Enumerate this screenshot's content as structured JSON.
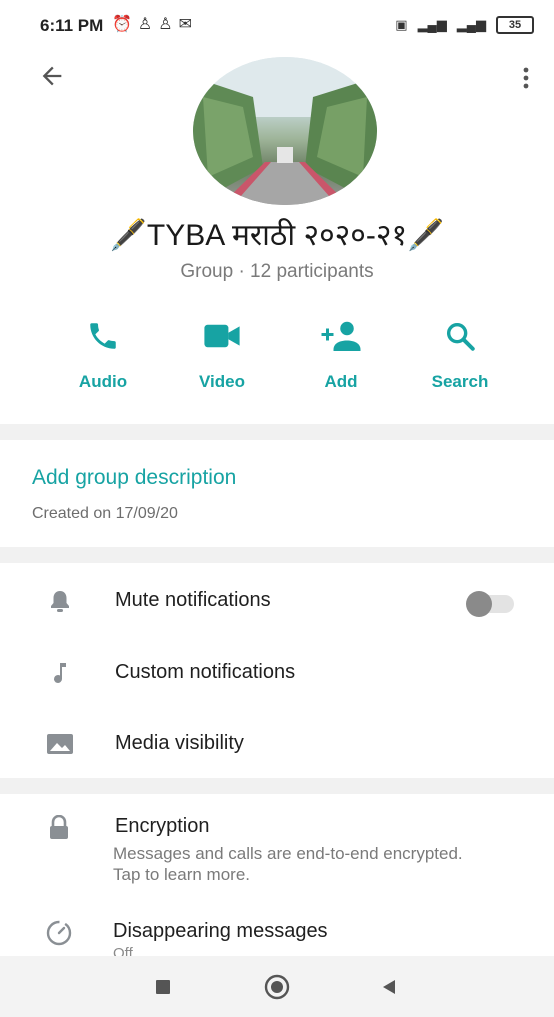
{
  "status_bar": {
    "time": "6:11 PM",
    "left_icons": [
      "alarm-off-icon",
      "person-icon",
      "person-icon",
      "gmail-icon"
    ],
    "right_icons": [
      "vibrate-icon",
      "signal-4g-icon",
      "signal-icon"
    ],
    "battery_level": "35"
  },
  "header": {
    "back_icon": "arrow-back-icon",
    "menu_icon": "more-vert-icon"
  },
  "group": {
    "title": "🖋️TYBA मराठी २०२०-२१🖋️",
    "meta": "Group · 12 participants"
  },
  "actions": [
    {
      "label": "Audio",
      "icon": "phone-icon"
    },
    {
      "label": "Video",
      "icon": "videocam-icon"
    },
    {
      "label": "Add",
      "icon": "person-add-icon"
    },
    {
      "label": "Search",
      "icon": "search-icon"
    }
  ],
  "description": {
    "link": "Add group description",
    "created": "Created on 17/09/20"
  },
  "settings": {
    "mute": {
      "label": "Mute notifications",
      "enabled": false
    },
    "custom": {
      "label": "Custom notifications"
    },
    "media": {
      "label": "Media visibility"
    }
  },
  "encryption": {
    "title": "Encryption",
    "subtitle": "Messages and calls are end-to-end encrypted. Tap to learn more."
  },
  "disappearing": {
    "title": "Disappearing messages",
    "subtitle": "Off"
  },
  "colors": {
    "accent": "#17a3a3",
    "icon_gray": "#8a8f94"
  }
}
